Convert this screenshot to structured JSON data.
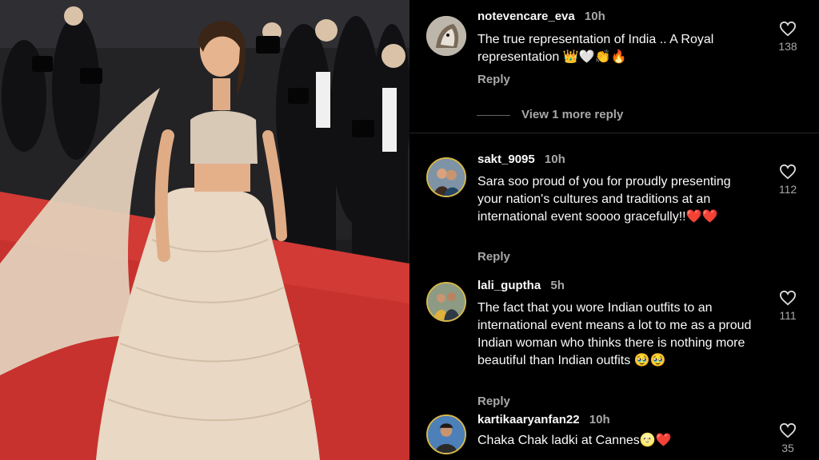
{
  "photo": {
    "alt_icon": "red-carpet-photo",
    "colors": {
      "carpet": "#d13a35",
      "dress": "#e8d8c4",
      "background": "#1d1d1f"
    }
  },
  "comments": [
    {
      "username": "notevencare_eva",
      "time": "10h",
      "text": "The true representation of India .. A Royal representation 👑🤍👏🔥",
      "reply_label": "Reply",
      "likes": "138"
    },
    {
      "username": "sakt_9095",
      "time": "10h",
      "text": "Sara soo proud of you for proudly presenting your nation's cultures and traditions at an international event soooo gracefully!!❤️❤️",
      "reply_label": "Reply",
      "likes": "112"
    },
    {
      "username": "lali_guptha",
      "time": "5h",
      "text": "The fact that you wore Indian outfits to an international event means a lot to me as a proud Indian woman who thinks there is nothing more beautiful than Indian outfits 🥹🥹",
      "reply_label": "Reply",
      "likes": "111"
    },
    {
      "username": "kartikaaryanfan22",
      "time": "10h",
      "text": "Chaka Chak ladki at Cannes🌝❤️",
      "likes": "35"
    }
  ],
  "view_replies": "View 1 more reply",
  "colors": {
    "background": "#000000",
    "text": "#fafafa",
    "muted": "#a8a8a8",
    "heart": "#dddddd"
  }
}
